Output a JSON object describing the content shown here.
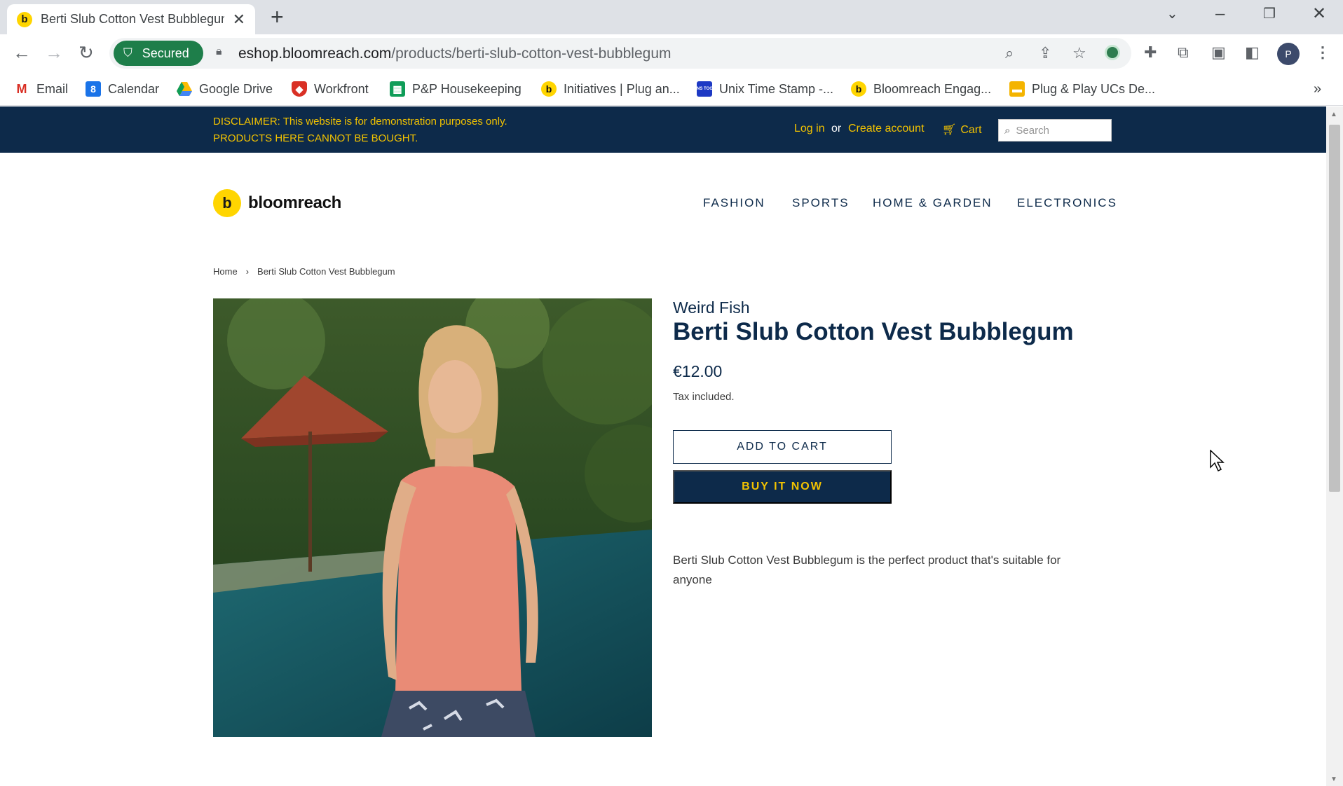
{
  "browser": {
    "tab_title": "Berti Slub Cotton Vest Bubblegum",
    "tab_favicon_letter": "b",
    "new_tab_glyph": "+",
    "secured_label": "Secured",
    "url_host": "eshop.bloomreach.com",
    "url_path": "/products/berti-slub-cotton-vest-bubblegum",
    "profile_initial": "P"
  },
  "bookmarks": [
    {
      "label": "Email",
      "icon": "gmail-icon"
    },
    {
      "label": "Calendar",
      "icon": "calendar-icon",
      "glyph": "8"
    },
    {
      "label": "Google Drive",
      "icon": "drive-icon"
    },
    {
      "label": "Workfront",
      "icon": "workfront-icon"
    },
    {
      "label": "P&P Housekeeping",
      "icon": "sheets-icon"
    },
    {
      "label": "Initiatives | Plug an...",
      "icon": "bloomreach-icon",
      "glyph": "b"
    },
    {
      "label": "Unix Time Stamp -...",
      "icon": "devtools-icon",
      "glyph": "DANS TOOLS"
    },
    {
      "label": "Bloomreach Engag...",
      "icon": "bloomreach-icon",
      "glyph": "b"
    },
    {
      "label": "Plug & Play UCs De...",
      "icon": "slides-icon"
    }
  ],
  "bookmarks_more": "»",
  "site": {
    "disclaimer": "DISCLAIMER: This website is for demonstration purposes only. PRODUCTS HERE CANNOT BE BOUGHT.",
    "login_label": "Log in",
    "or_label": "or",
    "create_account_label": "Create account",
    "cart_label": "Cart",
    "search_placeholder": "Search",
    "logo_letter": "b",
    "logo_text": "bloomreach",
    "nav": [
      "FASHION",
      "SPORTS",
      "HOME & GARDEN",
      "ELECTRONICS"
    ],
    "breadcrumb": {
      "home": "Home",
      "sep": "›",
      "current": "Berti Slub Cotton Vest Bubblegum"
    }
  },
  "product": {
    "vendor": "Weird Fish",
    "title": "Berti Slub Cotton Vest Bubblegum",
    "price": "€12.00",
    "tax_note": "Tax included.",
    "add_to_cart": "ADD TO CART",
    "buy_now": "BUY IT NOW",
    "description": "Berti Slub Cotton Vest Bubblegum is the perfect product that's suitable for anyone"
  },
  "colors": {
    "navy": "#0d2a4a",
    "gold": "#f2c200",
    "brand_yellow": "#ffd500",
    "secured_green": "#1e7e4a"
  }
}
